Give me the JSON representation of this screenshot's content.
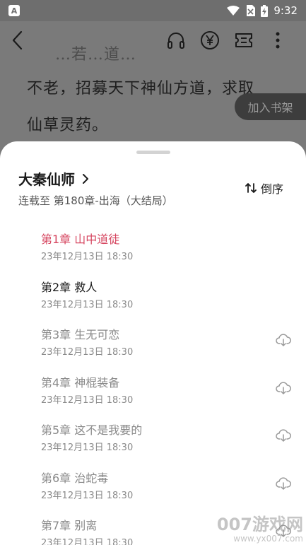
{
  "status_bar": {
    "app_badge": "A",
    "time": "9:32"
  },
  "reader": {
    "line_faded": "…若…道…",
    "line_1": "不老，招募天下神仙方道，求取",
    "line_2": "仙草灵药。",
    "add_to_shelf": "加入书架"
  },
  "sheet": {
    "book_title": "大秦仙师",
    "progress": "连载至 第180章-出海（大结局）",
    "sort_label": "倒序",
    "chapters": [
      {
        "title": "第1章 山中道徒",
        "date": "23年12月13日 18:30",
        "state": "active",
        "download": false
      },
      {
        "title": "第2章 救人",
        "date": "23年12月13日 18:30",
        "state": "read",
        "download": false
      },
      {
        "title": "第3章 生无可恋",
        "date": "23年12月13日 18:30",
        "state": "unread",
        "download": true
      },
      {
        "title": "第4章 神棍装备",
        "date": "23年12月13日 18:30",
        "state": "unread",
        "download": true
      },
      {
        "title": "第5章 这不是我要的",
        "date": "23年12月13日 18:30",
        "state": "unread",
        "download": true
      },
      {
        "title": "第6章 治蛇毒",
        "date": "23年12月13日 18:30",
        "state": "unread",
        "download": true
      },
      {
        "title": "第7章 别离",
        "date": "23年12月13日 18:30",
        "state": "unread",
        "download": true
      }
    ]
  },
  "watermark": {
    "brand": "007游戏网",
    "url": "www.yx007.com"
  },
  "colors": {
    "active_chapter": "#d6455f",
    "overlay": "#7a7a7a"
  }
}
